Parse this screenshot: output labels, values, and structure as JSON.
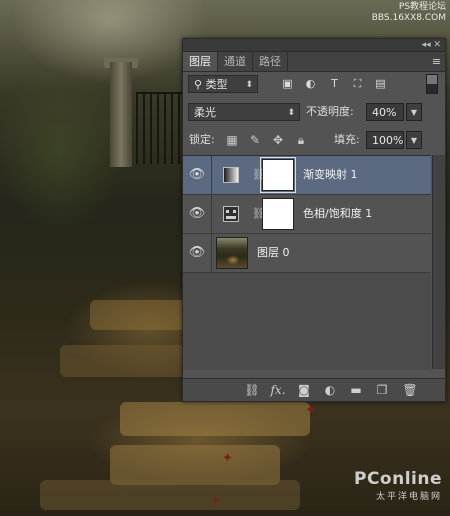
{
  "watermark": {
    "top_line1": "PS教程论坛",
    "top_line2": "BBS.16XX8.COM",
    "bottom_logo": "PConline",
    "bottom_sub": "太平洋电脑网"
  },
  "panel": {
    "tabs": [
      {
        "label": "图层",
        "active": true
      },
      {
        "label": "通道",
        "active": false
      },
      {
        "label": "路径",
        "active": false
      }
    ],
    "title_controls": "◂◂ ✕",
    "menu_icon": "≡",
    "filter": {
      "search_icon": "magnifier-icon",
      "kind_label": "类型",
      "icons": [
        "image-filter-icon",
        "adjustment-filter-icon",
        "type-filter-icon",
        "shape-filter-icon",
        "smart-object-filter-icon"
      ]
    },
    "blend": {
      "mode": "柔光",
      "opacity_label": "不透明度:",
      "opacity_value": "40%"
    },
    "lock": {
      "label": "锁定:",
      "icons": [
        "lock-transparent-icon",
        "lock-image-icon",
        "lock-position-icon",
        "lock-all-icon"
      ],
      "fill_label": "填充:",
      "fill_value": "100%"
    },
    "layers": [
      {
        "name": "渐变映射 1",
        "type": "gradient-map",
        "selected": true,
        "visible": true
      },
      {
        "name": "色相/饱和度 1",
        "type": "hue-saturation",
        "selected": false,
        "visible": true
      },
      {
        "name": "图层 0",
        "type": "pixel",
        "selected": false,
        "visible": true
      }
    ],
    "footer_icons": [
      "link-layers-icon",
      "fx-icon",
      "add-mask-icon",
      "adjustment-layer-icon",
      "new-group-icon",
      "new-layer-icon",
      "trash-icon"
    ],
    "footer_fx": "fx."
  }
}
